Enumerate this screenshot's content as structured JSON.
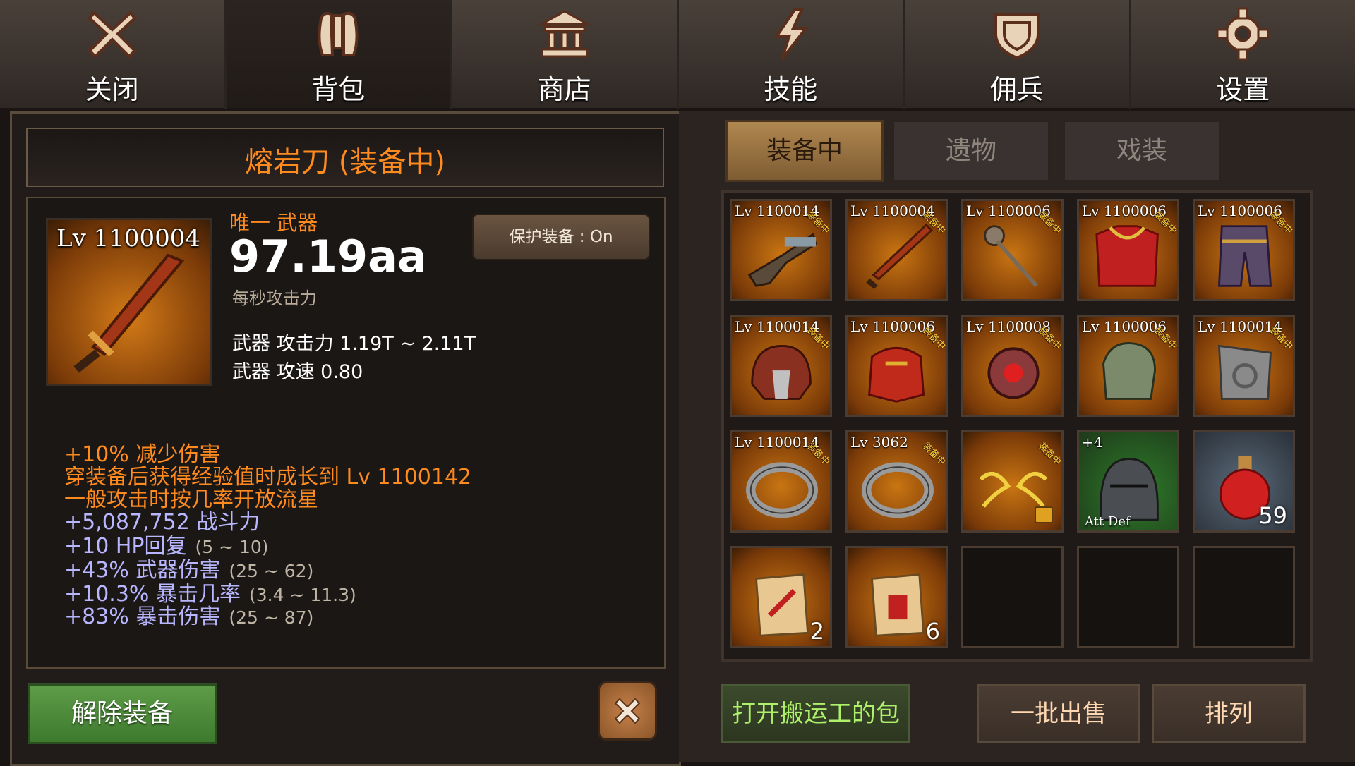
{
  "nav": [
    {
      "label": "关闭",
      "icon": "close-icon"
    },
    {
      "label": "背包",
      "icon": "backpack-icon"
    },
    {
      "label": "商店",
      "icon": "shop-icon"
    },
    {
      "label": "技能",
      "icon": "lightning-icon"
    },
    {
      "label": "佣兵",
      "icon": "shield-icon"
    },
    {
      "label": "设置",
      "icon": "gear-icon"
    }
  ],
  "detail": {
    "title": "熔岩刀 (装备中)",
    "item_level": "Lv 1100004",
    "rarity": "唯一 武器",
    "dps": "97.19aa",
    "dps_label": "每秒攻击力",
    "protect": "保护装备 : On",
    "stats": [
      "武器 攻击力 1.19T ~ 2.11T",
      "武器 攻速 0.80"
    ],
    "bonuses": [
      {
        "text": "+10% 减少伤害",
        "range": "",
        "color": "orange"
      },
      {
        "text": "穿装备后获得经验值时成长到 Lv 1100142",
        "range": "",
        "color": "orange"
      },
      {
        "text": "一般攻击时按几率开放流星",
        "range": "",
        "color": "orange"
      },
      {
        "text": "+5,087,752 战斗力",
        "range": "",
        "color": "blue"
      },
      {
        "text": "+10 HP回复",
        "range": "(5 ~ 10)",
        "color": "blue"
      },
      {
        "text": "+43% 武器伤害",
        "range": "(25 ~ 62)",
        "color": "blue"
      },
      {
        "text": "+10.3% 暴击几率",
        "range": "(3.4 ~ 11.3)",
        "color": "blue"
      },
      {
        "text": "+83% 暴击伤害",
        "range": "(25 ~ 87)",
        "color": "blue"
      }
    ],
    "unequip_label": "解除装备"
  },
  "subtabs": [
    "装备中",
    "遗物",
    "戏装"
  ],
  "equipped_tag": "装备中",
  "inventory": [
    {
      "level": "Lv 1100014",
      "equipped": true,
      "count": "",
      "icon": "flintlock-gun-icon"
    },
    {
      "level": "Lv 1100004",
      "equipped": true,
      "count": "",
      "icon": "lava-blade-icon"
    },
    {
      "level": "Lv 1100006",
      "equipped": true,
      "count": "",
      "icon": "mace-staff-icon"
    },
    {
      "level": "Lv 1100006",
      "equipped": true,
      "count": "",
      "icon": "red-armor-icon"
    },
    {
      "level": "Lv 1100006",
      "equipped": true,
      "count": "",
      "icon": "leg-armor-icon"
    },
    {
      "level": "Lv 1100014",
      "equipped": true,
      "count": "",
      "icon": "helmet-icon"
    },
    {
      "level": "Lv 1100006",
      "equipped": true,
      "count": "",
      "icon": "shoulder-armor-icon"
    },
    {
      "level": "Lv 1100008",
      "equipped": true,
      "count": "",
      "icon": "amulet-icon"
    },
    {
      "level": "Lv 1100006",
      "equipped": true,
      "count": "",
      "icon": "steel-gauntlet-icon"
    },
    {
      "level": "Lv 1100014",
      "equipped": true,
      "count": "",
      "icon": "cloak-icon"
    },
    {
      "level": "Lv 1100014",
      "equipped": true,
      "count": "",
      "icon": "ring-icon"
    },
    {
      "level": "Lv 3062",
      "equipped": true,
      "count": "",
      "icon": "ring-icon"
    },
    {
      "level": "",
      "equipped": true,
      "count": "",
      "icon": "golden-wings-icon",
      "locked": true
    },
    {
      "level": "+4",
      "equipped": false,
      "count": "",
      "icon": "knight-helmet-icon",
      "arrows": "Att Def"
    },
    {
      "level": "",
      "equipped": false,
      "count": "59",
      "icon": "red-potion-icon"
    },
    {
      "level": "",
      "equipped": false,
      "count": "2",
      "icon": "scroll-sword-icon"
    },
    {
      "level": "",
      "equipped": false,
      "count": "6",
      "icon": "scroll-armor-icon"
    },
    {
      "level": "",
      "equipped": false,
      "count": "",
      "icon": "",
      "empty": true
    },
    {
      "level": "",
      "equipped": false,
      "count": "",
      "icon": "",
      "empty": true
    },
    {
      "level": "",
      "equipped": false,
      "count": "",
      "icon": "",
      "empty": true
    }
  ],
  "buttons": {
    "porter": "打开搬运工的包",
    "bulk_sell": "一批出售",
    "sort": "排列"
  }
}
